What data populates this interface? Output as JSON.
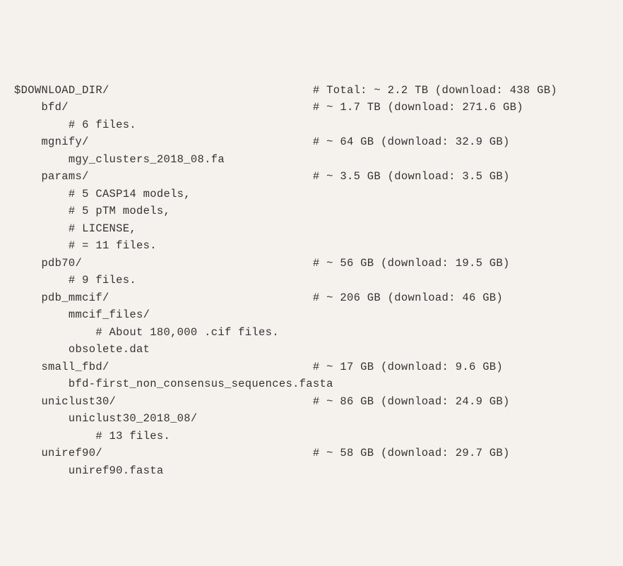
{
  "lines": [
    {
      "indent": 0,
      "text": "$DOWNLOAD_DIR/",
      "comment": "# Total: ~ 2.2 TB (download: 438 GB)"
    },
    {
      "indent": 1,
      "text": "bfd/",
      "comment": "# ~ 1.7 TB (download: 271.6 GB)"
    },
    {
      "indent": 2,
      "text": "# 6 files.",
      "comment": ""
    },
    {
      "indent": 1,
      "text": "mgnify/",
      "comment": "# ~ 64 GB (download: 32.9 GB)"
    },
    {
      "indent": 2,
      "text": "mgy_clusters_2018_08.fa",
      "comment": ""
    },
    {
      "indent": 1,
      "text": "params/",
      "comment": "# ~ 3.5 GB (download: 3.5 GB)"
    },
    {
      "indent": 2,
      "text": "# 5 CASP14 models,",
      "comment": ""
    },
    {
      "indent": 2,
      "text": "# 5 pTM models,",
      "comment": ""
    },
    {
      "indent": 2,
      "text": "# LICENSE,",
      "comment": ""
    },
    {
      "indent": 2,
      "text": "# = 11 files.",
      "comment": ""
    },
    {
      "indent": 1,
      "text": "pdb70/",
      "comment": "# ~ 56 GB (download: 19.5 GB)"
    },
    {
      "indent": 2,
      "text": "# 9 files.",
      "comment": ""
    },
    {
      "indent": 1,
      "text": "pdb_mmcif/",
      "comment": "# ~ 206 GB (download: 46 GB)"
    },
    {
      "indent": 2,
      "text": "mmcif_files/",
      "comment": ""
    },
    {
      "indent": 3,
      "text": "# About 180,000 .cif files.",
      "comment": ""
    },
    {
      "indent": 2,
      "text": "obsolete.dat",
      "comment": ""
    },
    {
      "indent": 1,
      "text": "small_fbd/",
      "comment": "# ~ 17 GB (download: 9.6 GB)"
    },
    {
      "indent": 2,
      "text": "bfd-first_non_consensus_sequences.fasta",
      "comment": ""
    },
    {
      "indent": 1,
      "text": "uniclust30/",
      "comment": "# ~ 86 GB (download: 24.9 GB)"
    },
    {
      "indent": 2,
      "text": "uniclust30_2018_08/",
      "comment": ""
    },
    {
      "indent": 3,
      "text": "# 13 files.",
      "comment": ""
    },
    {
      "indent": 1,
      "text": "uniref90/",
      "comment": "# ~ 58 GB (download: 29.7 GB)"
    },
    {
      "indent": 2,
      "text": "uniref90.fasta",
      "comment": ""
    }
  ],
  "layout": {
    "indentSize": 4,
    "commentColumn": 44
  }
}
